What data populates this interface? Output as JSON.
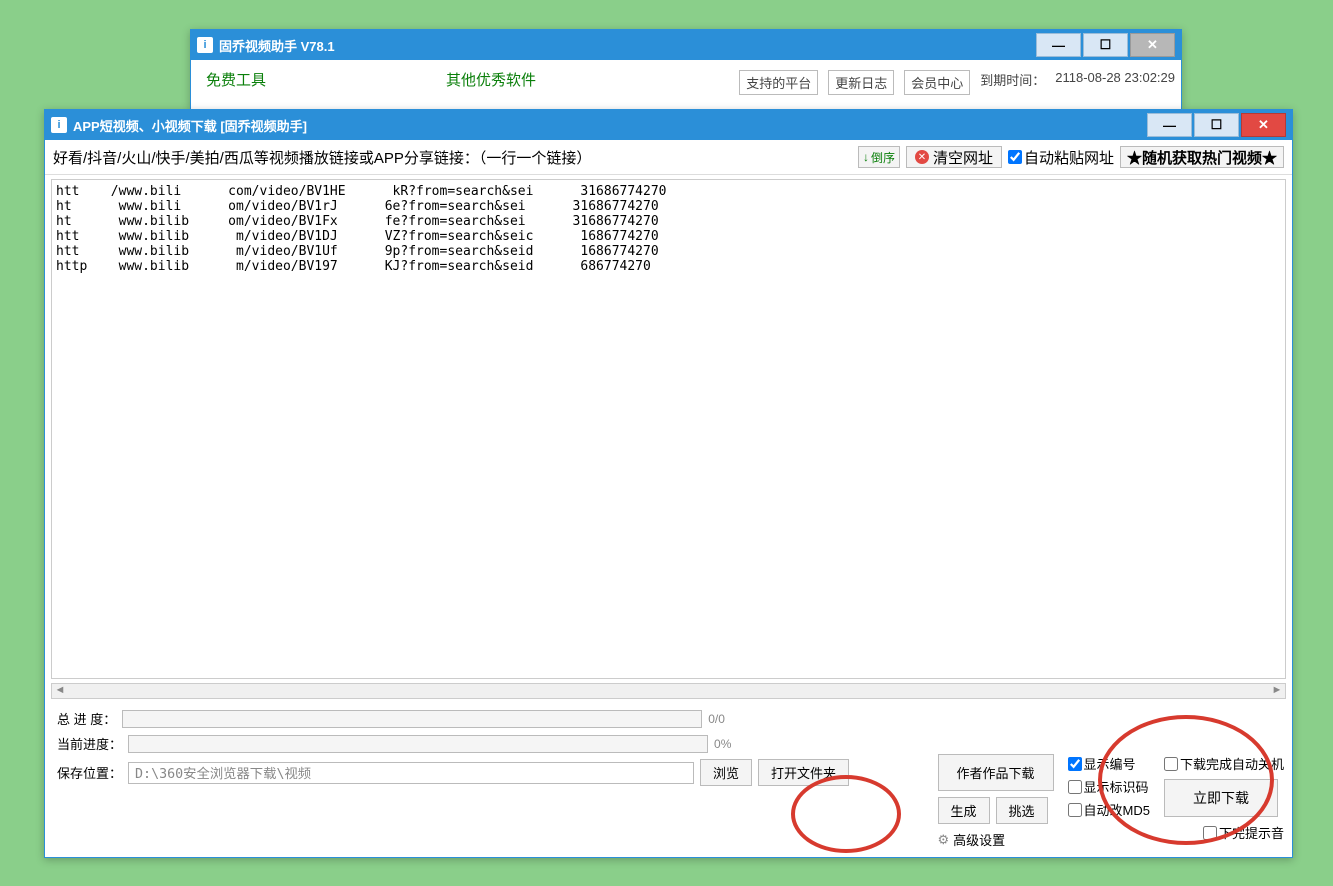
{
  "bg_window": {
    "title": "固乔视频助手 V78.1",
    "link1": "免费工具",
    "link2": "其他优秀软件",
    "platform": "支持的平台",
    "updatelog": "更新日志",
    "member": "会员中心",
    "expire_label": "到期时间：",
    "expire_value": "2118-08-28 23:02:29"
  },
  "main_window": {
    "title": "APP短视频、小视频下载 [固乔视频助手]",
    "instruction": "好看/抖音/火山/快手/美拍/西瓜等视频播放链接或APP分享链接：（一行一个链接）",
    "reverse": "倒序",
    "clear_url": "清空网址",
    "auto_paste": "自动粘贴网址",
    "random_hot": "★随机获取热门视频★",
    "urls": [
      "htt    /www.bili      com/video/BV1HE      kR?from=search&sei      31686774270",
      "ht      www.bili      om/video/BV1rJ      6e?from=search&sei      31686774270",
      "ht      www.bilib     om/video/BV1Fx      fe?from=search&sei      31686774270",
      "htt     www.bilib      m/video/BV1DJ      VZ?from=search&seic      1686774270",
      "htt     www.bilib      m/video/BV1Uf      9p?from=search&seid      1686774270",
      "http    www.bilib      m/video/BV197      KJ?from=search&seid      686774270"
    ],
    "total_progress_label": "总 进 度：",
    "total_progress_text": "0/0",
    "current_progress_label": "当前进度：",
    "current_progress_text": "0%",
    "save_label": "保存位置：",
    "save_path": "D:\\360安全浏览器下载\\视频",
    "browse": "浏览",
    "open_folder": "打开文件夹",
    "author_dl": "作者作品下载",
    "generate": "生成",
    "pick": "挑选",
    "show_index": "显示编号",
    "show_idcode": "显示标识码",
    "auto_md5": "自动改MD5",
    "advanced": "高级设置",
    "auto_shutdown": "下载完成自动关机",
    "download_now": "立即下载",
    "done_sound": "下完提示音"
  }
}
